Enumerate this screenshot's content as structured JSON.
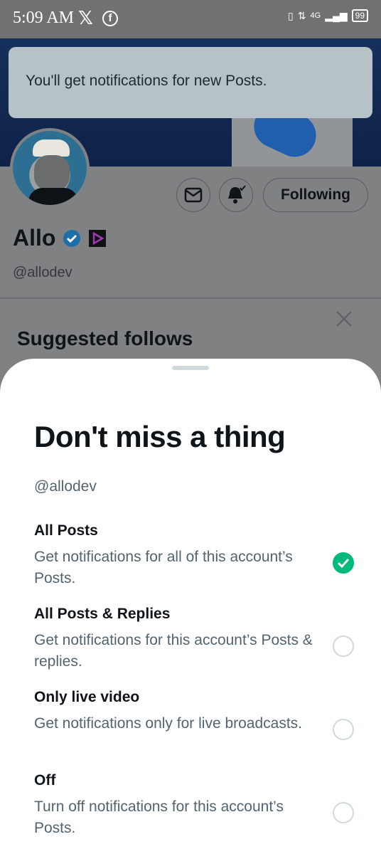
{
  "status_bar": {
    "time": "5:09 AM",
    "network": "4G",
    "battery": "99",
    "icons": [
      "x-logo-icon",
      "facebook-icon",
      "vibrate-icon",
      "data-arrows-icon",
      "signal-icon",
      "battery-icon"
    ]
  },
  "toast": {
    "message": "You'll get notifications for new Posts."
  },
  "profile": {
    "name": "Allo",
    "handle": "@allodev",
    "following_label": "Following",
    "icons": [
      "mail-icon",
      "bell-icon",
      "verified-icon",
      "badge-icon"
    ]
  },
  "suggested": {
    "title": "Suggested follows"
  },
  "sheet": {
    "title": "Don't miss a thing",
    "handle": "@allodev",
    "options": [
      {
        "title": "All Posts",
        "desc": "Get notifications for all of this account’s Posts.",
        "selected": true
      },
      {
        "title": "All Posts & Replies",
        "desc": "Get notifications for this account’s Posts & replies.",
        "selected": false
      },
      {
        "title": "Only live video",
        "desc": "Get notifications only for live broadcasts.",
        "selected": false
      },
      {
        "title": "Off",
        "desc": "Turn off notifications for this account’s Posts.",
        "selected": false
      }
    ]
  },
  "colors": {
    "accent_green": "#00ba7c",
    "verified_blue": "#1d9bf0",
    "overlay": "#7f8183"
  }
}
